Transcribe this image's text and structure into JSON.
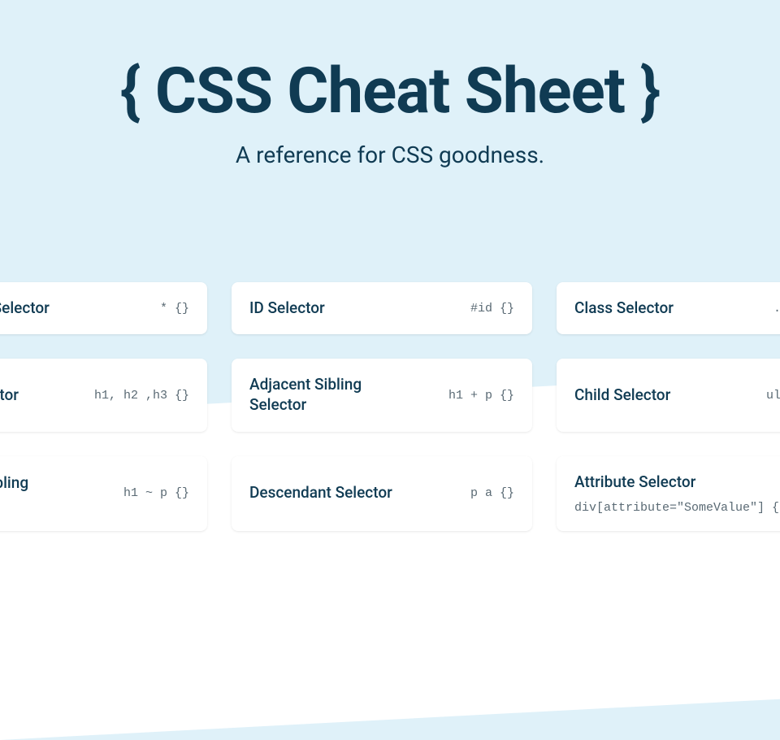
{
  "hero": {
    "title": "{ CSS Cheat Sheet }",
    "subtitle": "A reference for CSS goodness."
  },
  "cards": [
    {
      "title": "Universal Selector",
      "code": "* {}"
    },
    {
      "title": "ID Selector",
      "code": "#id {}"
    },
    {
      "title": "Class Selector",
      "code": ".class {}"
    },
    {
      "title": "Type Selector",
      "code": "h1, h2 ,h3 {}"
    },
    {
      "title": "Adjacent Sibling Selector",
      "code": "h1 + p {}"
    },
    {
      "title": "Child Selector",
      "code": "ul > li {}"
    },
    {
      "title": "General Sibling Selector",
      "code": "h1 ~ p {}"
    },
    {
      "title": "Descendant Selector",
      "code": "p a {}"
    },
    {
      "title": "Attribute Selector",
      "code": "div[attribute=\"SomeValue\"] {}"
    }
  ]
}
